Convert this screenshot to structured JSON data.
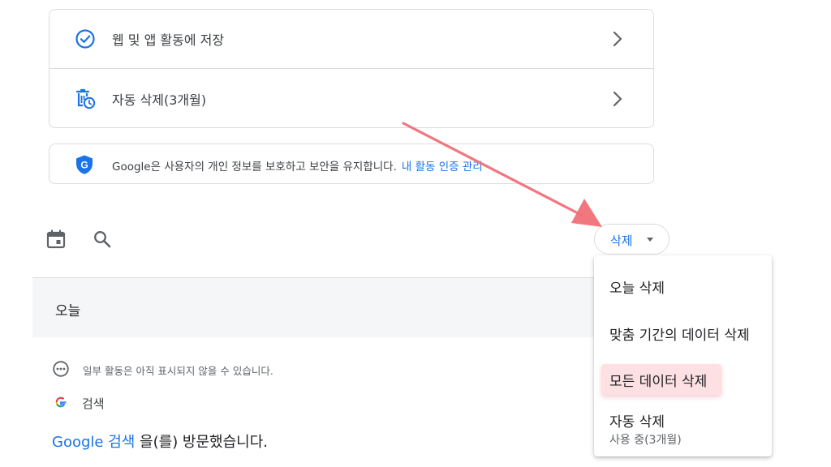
{
  "activity_controls": {
    "items": [
      {
        "label": "웹 및 앱 활동에 저장",
        "icon": "check-circle-icon"
      },
      {
        "label": "자동 삭제(3개월)",
        "icon": "auto-delete-icon"
      }
    ]
  },
  "privacy_banner": {
    "text": "Google은 사용자의 개인 정보를 보호하고 보안을 유지합니다.",
    "link": "내 활동 인증 관리",
    "icon": "google-shield-icon"
  },
  "toolbar": {
    "calendar_icon": "calendar-icon",
    "search_icon": "search-icon",
    "delete_button": "삭제"
  },
  "feed": {
    "date_header": "오늘",
    "notice": "일부 활동은 아직 표시되지 않을 수 있습니다.",
    "service": "검색",
    "visit_link": "Google 검색",
    "visit_suffix": " 을(를) 방문했습니다."
  },
  "delete_menu": {
    "items": [
      {
        "label": "오늘 삭제"
      },
      {
        "label": "맞춤 기간의 데이터 삭제"
      },
      {
        "label": "모든 데이터 삭제",
        "highlighted": true
      },
      {
        "label": "자동 삭제",
        "sublabel": "사용 중(3개월)"
      }
    ]
  },
  "colors": {
    "accent": "#1a73e8",
    "annotation_arrow": "#f07078",
    "highlight": "#fde0e2"
  }
}
